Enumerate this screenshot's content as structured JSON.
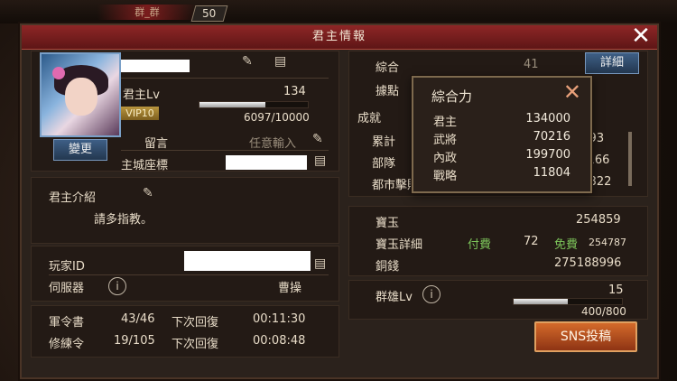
{
  "topbar": {
    "player_name": "群_群",
    "level": "50"
  },
  "window": {
    "title": "君主情報",
    "close": "✕"
  },
  "profile": {
    "lord_lv_label": "君主Lv",
    "lord_lv_value": "134",
    "vip": "VIP10",
    "exp_text": "6097/10000",
    "exp_fraction": 0.61,
    "change_button": "變更",
    "message_label": "留言",
    "message_value": "任意輸入",
    "castle_coord_label": "主城座標"
  },
  "intro": {
    "label": "君主介紹",
    "text": "請多指教。"
  },
  "account": {
    "player_id_label": "玩家ID",
    "server_label": "伺服器",
    "server_value": "曹操"
  },
  "orders": [
    {
      "label": "軍令書",
      "value": "43/46",
      "recover_label": "下次回復",
      "time": "00:11:30"
    },
    {
      "label": "修練令",
      "value": "19/105",
      "recover_label": "下次回復",
      "time": "00:08:48"
    }
  ],
  "stats": {
    "total_power_label": "綜合",
    "total_power_value": "41",
    "stronghold_label": "據點",
    "achievement_label": "成就",
    "detail_button": "詳細",
    "cumulative_label": "累計",
    "cumulative_value": "1593",
    "unit_label": "部隊",
    "unit_value": "91166",
    "city_defeat_label": "都市擊敗Pt",
    "city_defeat_value": "88822"
  },
  "currency": {
    "gem_label": "寶玉",
    "gem_value": "254859",
    "gem_detail_label": "寶玉詳細",
    "paid_label": "付費",
    "paid_value": "72",
    "free_label": "免費",
    "free_value": "254787",
    "copper_label": "銅錢",
    "copper_value": "275188996"
  },
  "hero": {
    "label": "群雄Lv",
    "level": "15",
    "exp_text": "400/800",
    "exp_fraction": 0.5
  },
  "sns_button": "SNS投稿",
  "popup": {
    "title": "綜合力",
    "rows": [
      {
        "label": "君主",
        "value": "134000"
      },
      {
        "label": "武將",
        "value": "70216"
      },
      {
        "label": "內政",
        "value": "199700"
      },
      {
        "label": "戰略",
        "value": "11804"
      }
    ]
  }
}
